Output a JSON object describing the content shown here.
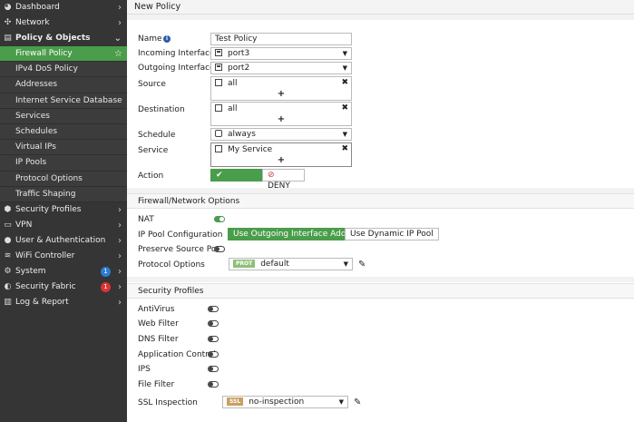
{
  "sidebar": {
    "top_items": [
      {
        "label": "Dashboard",
        "icon": "dashboard-icon"
      },
      {
        "label": "Network",
        "icon": "network-icon"
      },
      {
        "label": "Policy & Objects",
        "icon": "policy-icon"
      }
    ],
    "policy_sub": [
      "Firewall Policy",
      "IPv4 DoS Policy",
      "Addresses",
      "Internet Service Database",
      "Services",
      "Schedules",
      "Virtual IPs",
      "IP Pools",
      "Protocol Options",
      "Traffic Shaping"
    ],
    "bottom_items": [
      {
        "label": "Security Profiles",
        "icon": "security-profiles-icon"
      },
      {
        "label": "VPN",
        "icon": "vpn-icon"
      },
      {
        "label": "User & Authentication",
        "icon": "user-icon"
      },
      {
        "label": "WiFi Controller",
        "icon": "wifi-icon"
      },
      {
        "label": "System",
        "icon": "gear-icon",
        "badge": "1"
      },
      {
        "label": "Security Fabric",
        "icon": "fabric-icon",
        "badge": "1"
      },
      {
        "label": "Log & Report",
        "icon": "log-icon"
      }
    ]
  },
  "page_title": "New Policy",
  "form": {
    "name_label": "Name",
    "name_value": "Test Policy",
    "incoming_label": "Incoming Interface",
    "incoming_value": "port3",
    "outgoing_label": "Outgoing Interface",
    "outgoing_value": "port2",
    "source_label": "Source",
    "source_value": "all",
    "destination_label": "Destination",
    "destination_value": "all",
    "schedule_label": "Schedule",
    "schedule_value": "always",
    "service_label": "Service",
    "service_value": "My Service",
    "action_label": "Action",
    "accept_label": "ACCEPT",
    "deny_label": "DENY",
    "plus": "+",
    "remove": "✖"
  },
  "firewall": {
    "header": "Firewall/Network Options",
    "nat_label": "NAT",
    "nat_on": true,
    "ippool_label": "IP Pool Configuration",
    "use_outgoing": "Use Outgoing Interface Address",
    "use_dynamic": "Use Dynamic IP Pool",
    "preserve_label": "Preserve Source Port",
    "protocol_label": "Protocol Options",
    "protocol_tag": "PROT",
    "protocol_value": "default"
  },
  "profiles": {
    "header": "Security Profiles",
    "items": [
      "AntiVirus",
      "Web Filter",
      "DNS Filter",
      "Application Control",
      "IPS",
      "File Filter"
    ],
    "ssl_label": "SSL Inspection",
    "ssl_tag": "SSL",
    "ssl_value": "no-inspection"
  },
  "colors": {
    "sidebar_bg": "#353535",
    "active_green": "#4a9d4a",
    "badge_blue": "#2b7cd3",
    "badge_red": "#d33333",
    "prot_tag": "#8fbf7a",
    "ssl_tag": "#c8a060"
  }
}
